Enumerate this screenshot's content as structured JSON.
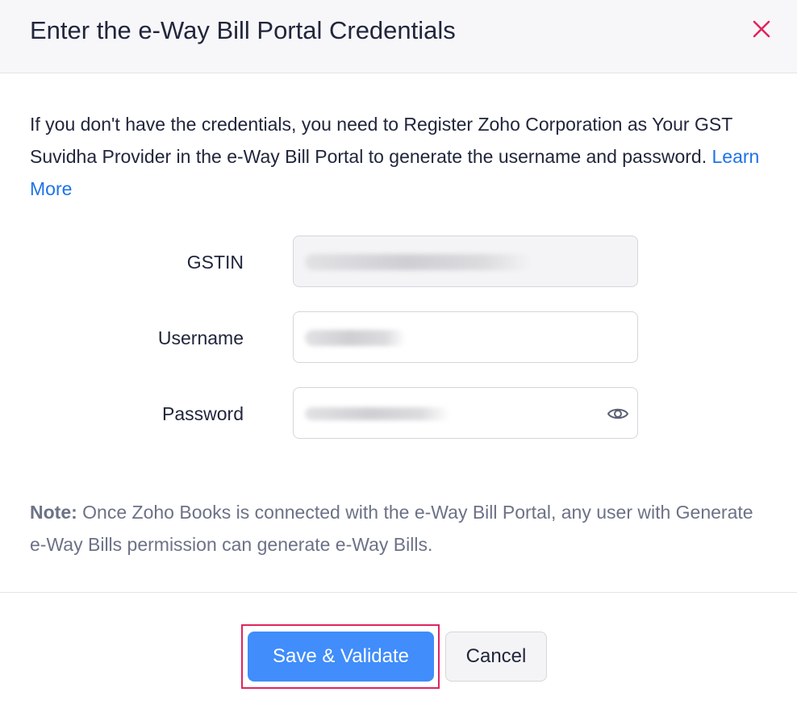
{
  "dialog": {
    "title": "Enter the e-Way Bill Portal Credentials",
    "close_icon": "close-icon",
    "close_color": "#e0245e"
  },
  "intro": {
    "text": "If you don't have the credentials, you need to Register Zoho Corporation as Your GST Suvidha Provider in the e-Way Bill Portal to generate the username and password.",
    "link_label": "Learn More"
  },
  "form": {
    "gstin_label": "GSTIN",
    "username_label": "Username",
    "password_label": "Password",
    "password_toggle_icon": "eye-icon"
  },
  "note": {
    "prefix": "Note:",
    "text": "Once Zoho Books is connected with the e-Way Bill Portal, any user with Generate e-Way Bills permission can generate e-Way Bills."
  },
  "footer": {
    "save_label": "Save & Validate",
    "cancel_label": "Cancel"
  },
  "colors": {
    "accent": "#408dfb",
    "link": "#1e73e8",
    "highlight": "#e0245e"
  }
}
